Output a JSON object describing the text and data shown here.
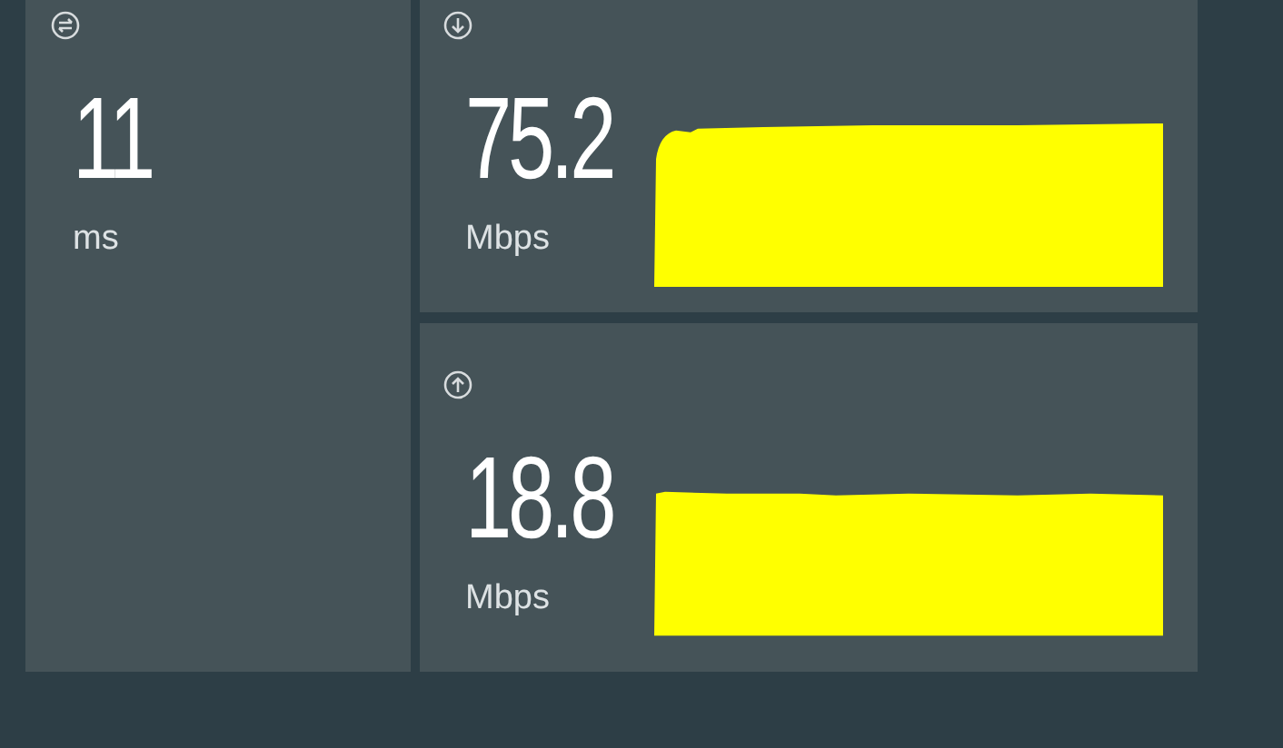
{
  "metrics": [
    {
      "kind": "ping",
      "value": "11",
      "unit": "ms"
    },
    {
      "kind": "download",
      "value": "75.2",
      "unit": "Mbps"
    },
    {
      "kind": "upload",
      "value": "18.8",
      "unit": "Mbps"
    }
  ]
}
